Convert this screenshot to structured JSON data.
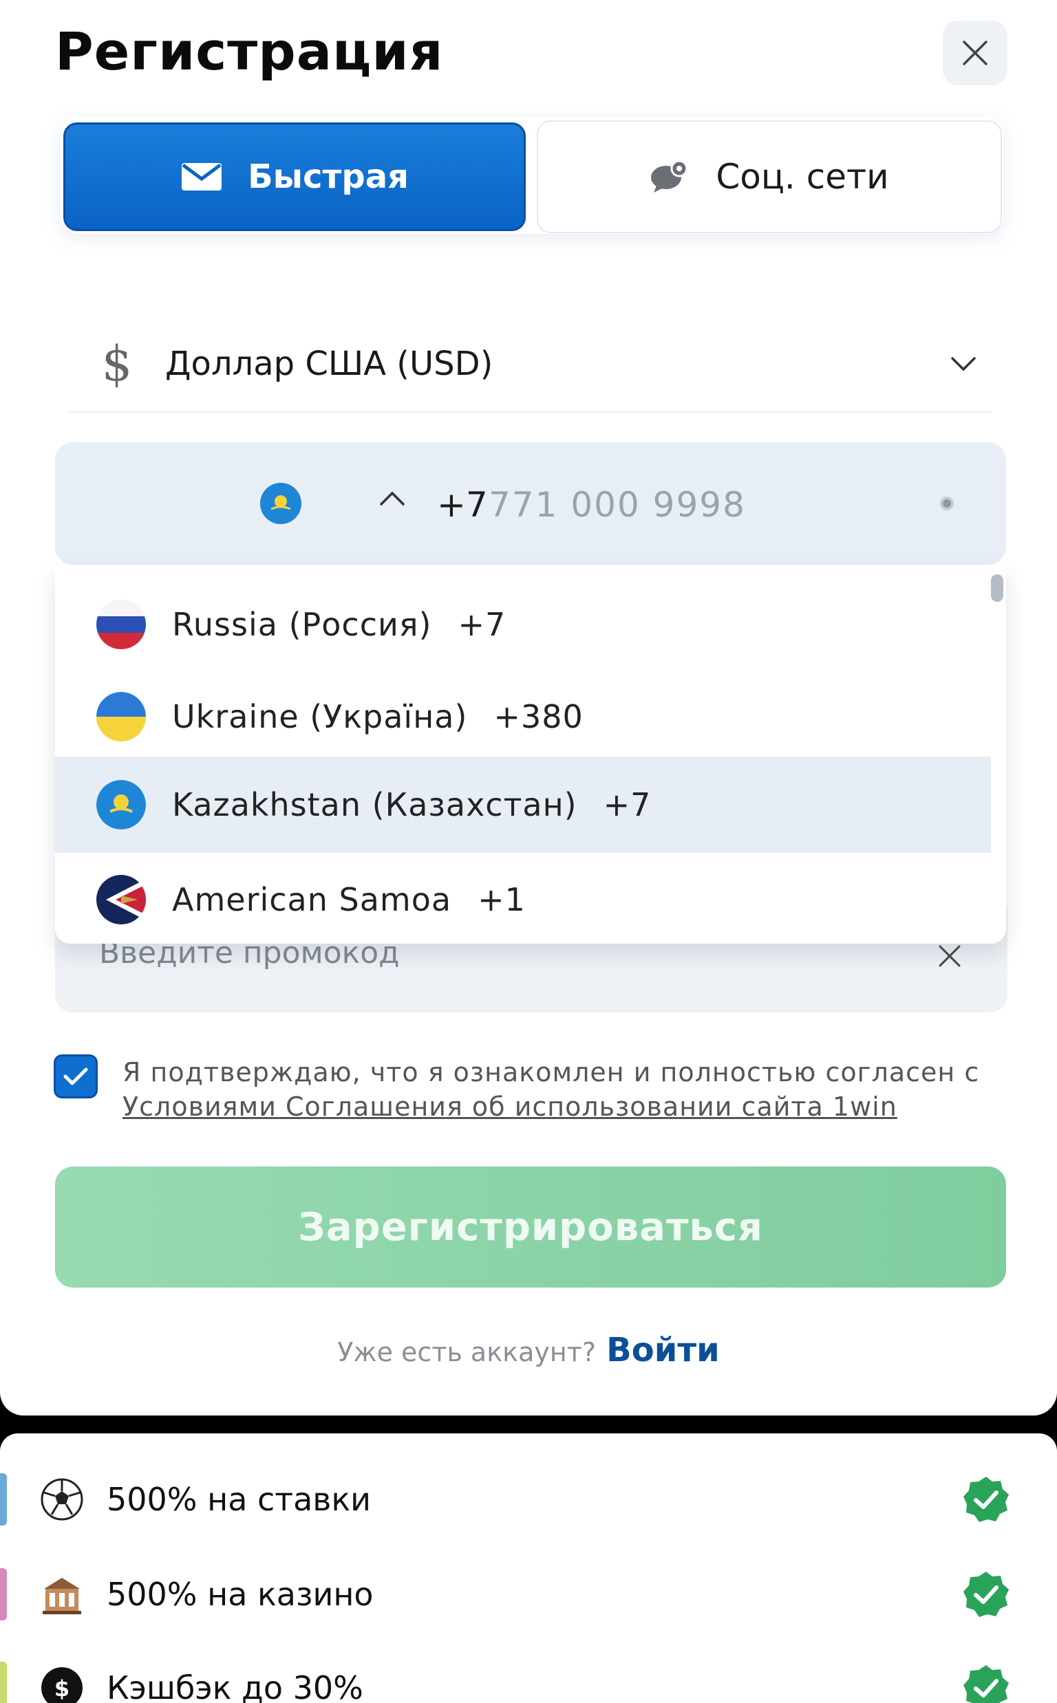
{
  "header": {
    "title": "Регистрация"
  },
  "tabs": [
    {
      "label": "Быстрая",
      "icon": "envelope-icon",
      "active": true
    },
    {
      "label": "Соц. сети",
      "icon": "chat-bubbles-icon",
      "active": false
    }
  ],
  "currency": {
    "symbol": "$",
    "label": "Доллар США (USD)"
  },
  "phone": {
    "prefix": "+7",
    "placeholder": "771 000 9998",
    "selected_flag": "kazakhstan"
  },
  "country_list": [
    {
      "name": "Russia (Россия)",
      "code": "+7",
      "flag": "russia"
    },
    {
      "name": "Ukraine (Україна)",
      "code": "+380",
      "flag": "ukraine"
    },
    {
      "name": "Kazakhstan (Казахстан)",
      "code": "+7",
      "flag": "kazakhstan",
      "highlighted": true
    },
    {
      "name": "American Samoa",
      "code": "+1",
      "flag": "american-samoa"
    }
  ],
  "promo": {
    "placeholder": "Введите промокод"
  },
  "agreement": {
    "checked": true,
    "text": "Я подтверждаю, что я ознакомлен и полностью согласен с",
    "link": "Условиями Соглашения об использовании сайта 1win"
  },
  "submit": {
    "label": "Зарегистрироваться"
  },
  "login": {
    "question": "Уже есть аккаунт?",
    "link": "Войти"
  },
  "bonuses": [
    {
      "label": "500% на ставки",
      "icon": "soccer-ball-icon",
      "accent": "#6aa8d8"
    },
    {
      "label": "500% на казино",
      "icon": "casino-icon",
      "accent": "#d48ab8"
    },
    {
      "label": "Кэшбэк до 30%",
      "icon": "cashback-icon",
      "accent": "#c8d86a"
    }
  ],
  "colors": {
    "primary": "#0a63c4",
    "submit": "#8ad3a7",
    "check": "#2aa35a"
  }
}
